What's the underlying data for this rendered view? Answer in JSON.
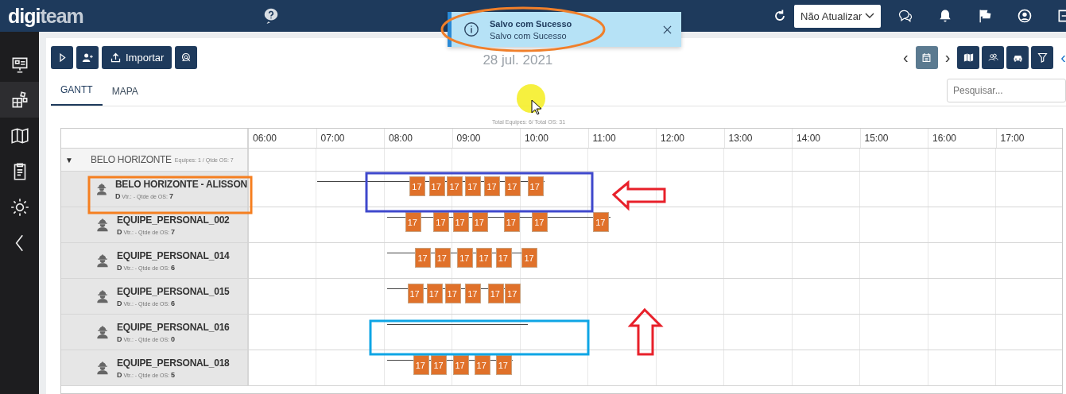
{
  "topbar": {
    "logo_a": "digi",
    "logo_b": "team",
    "refresh_select": {
      "value": "Não Atualizar"
    }
  },
  "sidebar": {
    "items": [
      {
        "selected": false
      },
      {
        "selected": true
      },
      {
        "selected": false
      },
      {
        "selected": false
      },
      {
        "selected": false
      },
      {
        "selected": false
      }
    ]
  },
  "toolbar": {
    "import_label": "Importar",
    "date": "28 jul. 2021",
    "date_nav": {
      "prev": "‹",
      "next": "›"
    },
    "collapse": "‹"
  },
  "toast": {
    "title": "Salvo com Sucesso",
    "message": "Salvo com Sucesso"
  },
  "tabs": [
    {
      "label": "GANTT",
      "selected": true
    },
    {
      "label": "MAPA",
      "selected": false
    }
  ],
  "search": {
    "placeholder": "Pesquisar..."
  },
  "gantt": {
    "summary": "Total Equipes: 6/ Total OS: 31",
    "hours": [
      "06:00",
      "07:00",
      "08:00",
      "09:00",
      "10:00",
      "11:00",
      "12:00",
      "13:00",
      "14:00",
      "15:00",
      "16:00",
      "17:00"
    ],
    "group": {
      "toggle": "▼",
      "name": "BELO HORIZONTE",
      "stats": "Equipes: 1 / Qtde OS: 7"
    },
    "teams": [
      {
        "name": "BELO HORIZONTE - ALISSON",
        "info": "**D** Vtr.: - Qtde de OS: **7**",
        "tasks": [
          {
            "label": "17"
          },
          {
            "label": "17"
          },
          {
            "label": "17"
          },
          {
            "label": "17"
          },
          {
            "label": "17"
          },
          {
            "label": "17"
          },
          {
            "label": "17"
          }
        ]
      },
      {
        "name": "EQUIPE_PERSONAL_002",
        "info": "**D** Vtr.: - Qtde de OS: **7**",
        "tasks": [
          {
            "label": "17"
          },
          {
            "label": "17"
          },
          {
            "label": "17"
          },
          {
            "label": "17"
          },
          {
            "label": "17"
          },
          {
            "label": "17"
          },
          {
            "label": "17"
          }
        ]
      },
      {
        "name": "EQUIPE_PERSONAL_014",
        "info": "**D** Vtr.: - Qtde de OS: **6**",
        "tasks": [
          {
            "label": "17"
          },
          {
            "label": "17"
          },
          {
            "label": "17"
          },
          {
            "label": "17"
          },
          {
            "label": "17"
          },
          {
            "label": "17"
          }
        ]
      },
      {
        "name": "EQUIPE_PERSONAL_015",
        "info": "**D** Vtr.: - Qtde de OS: **6**",
        "tasks": [
          {
            "label": "17"
          },
          {
            "label": "17"
          },
          {
            "label": "17"
          },
          {
            "label": "17"
          },
          {
            "label": "17"
          },
          {
            "label": "17"
          }
        ]
      },
      {
        "name": "EQUIPE_PERSONAL_016",
        "info": "**D** Vtr.: - Qtde de OS: **0**"
      },
      {
        "name": "EQUIPE_PERSONAL_018",
        "info": "**D** Vtr.: - Qtde de OS: **5**",
        "tasks": [
          {
            "label": "17"
          },
          {
            "label": "17"
          },
          {
            "label": "17"
          },
          {
            "label": "17"
          },
          {
            "label": "17"
          }
        ]
      }
    ]
  }
}
